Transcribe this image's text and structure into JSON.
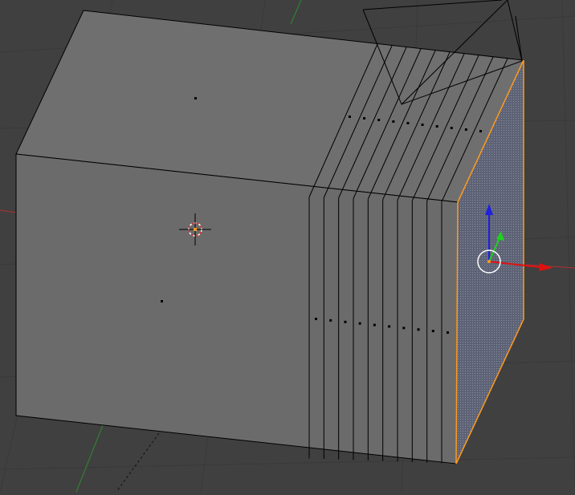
{
  "app": {
    "name": "3d-viewport",
    "mode": "edit-mode",
    "selection": "face"
  },
  "colors": {
    "background": "#404040",
    "grid_line": "#393939",
    "x_axis": "#b03030",
    "y_axis": "#2f8a2f",
    "mesh_face_top": "#6f6f6f",
    "mesh_face_front": "#6b6b6b",
    "mesh_edge": "#000000",
    "selected_edge": "#ff9a1f",
    "selected_face_fill": "#5d6275",
    "manipulator_x": "#e01010",
    "manipulator_y": "#20d020",
    "manipulator_z": "#2020e0",
    "camera_wire": "#000000"
  },
  "icons": {
    "cursor": "3d-cursor-icon",
    "manipulator": "transform-manipulator-icon",
    "camera": "camera-object-icon"
  },
  "mesh": {
    "loop_cut_count": 10,
    "face_dot_count": 2,
    "loop_face_dot_count": 10
  }
}
